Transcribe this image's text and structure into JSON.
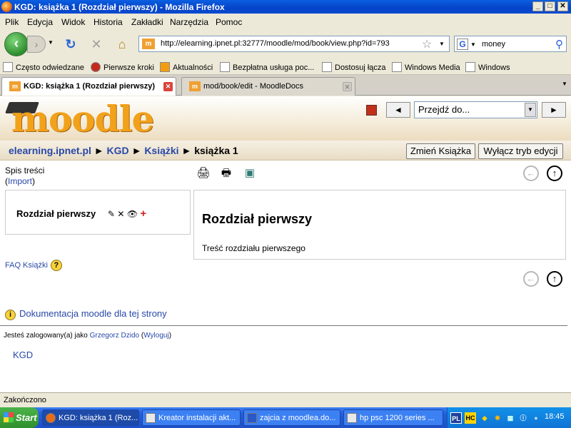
{
  "window": {
    "title": "KGD: książka 1 (Rozdział pierwszy) - Mozilla Firefox",
    "controls": {
      "minimize": "_",
      "maximize": "□",
      "close": "✕"
    }
  },
  "menu": [
    "Plik",
    "Edycja",
    "Widok",
    "Historia",
    "Zakładki",
    "Narzędzia",
    "Pomoc"
  ],
  "toolbar": {
    "url": "http://elearning.ipnet.pl:32777/moodle/mod/book/view.php?id=793",
    "search_value": "money",
    "url_favicon": "m"
  },
  "bookmarks": [
    "Często odwiedzane",
    "Pierwsze kroki",
    "Aktualności",
    "Bezpłatna usługa poc...",
    "Dostosuj łącza",
    "Windows Media",
    "Windows"
  ],
  "tabs": [
    {
      "label": "KGD: książka 1 (Rozdział pierwszy)",
      "active": true
    },
    {
      "label": "mod/book/edit - MoodleDocs",
      "active": false
    }
  ],
  "header": {
    "logo_text": "moodle",
    "jump_select": "Przejdź do...",
    "prev": "◄",
    "next": "►"
  },
  "breadcrumb": {
    "site": "elearning.ipnet.pl",
    "course": "KGD",
    "module": "Książki",
    "current": "książka 1",
    "sep": "►"
  },
  "buttons": {
    "change_book": "Zmień Książka",
    "edit_off": "Wyłącz tryb edycji"
  },
  "toc": {
    "title": "Spis treści",
    "import_open": "(",
    "import_label": "Import",
    "import_close": ")",
    "chapter": "Rozdział pierwszy"
  },
  "content": {
    "heading": "Rozdział pierwszy",
    "body": "Treść rozdziału pierwszego"
  },
  "faq": "FAQ Książki",
  "doc_link": "Dokumentacja moodle dla tej strony",
  "footer": {
    "logged_prefix": "Jesteś zalogowany(a) jako",
    "user": "Grzegorz Dzido",
    "logout": "Wyloguj",
    "course": "KGD"
  },
  "status": "Zakończono",
  "taskbar": {
    "start": "Start",
    "tasks": [
      "KGD: książka 1 (Roz...",
      "Kreator instalacji akt...",
      "zajcia z moodlea.do...",
      "hp psc 1200 series ..."
    ],
    "tray": [
      "PL",
      "HC"
    ],
    "time": "18:45"
  }
}
